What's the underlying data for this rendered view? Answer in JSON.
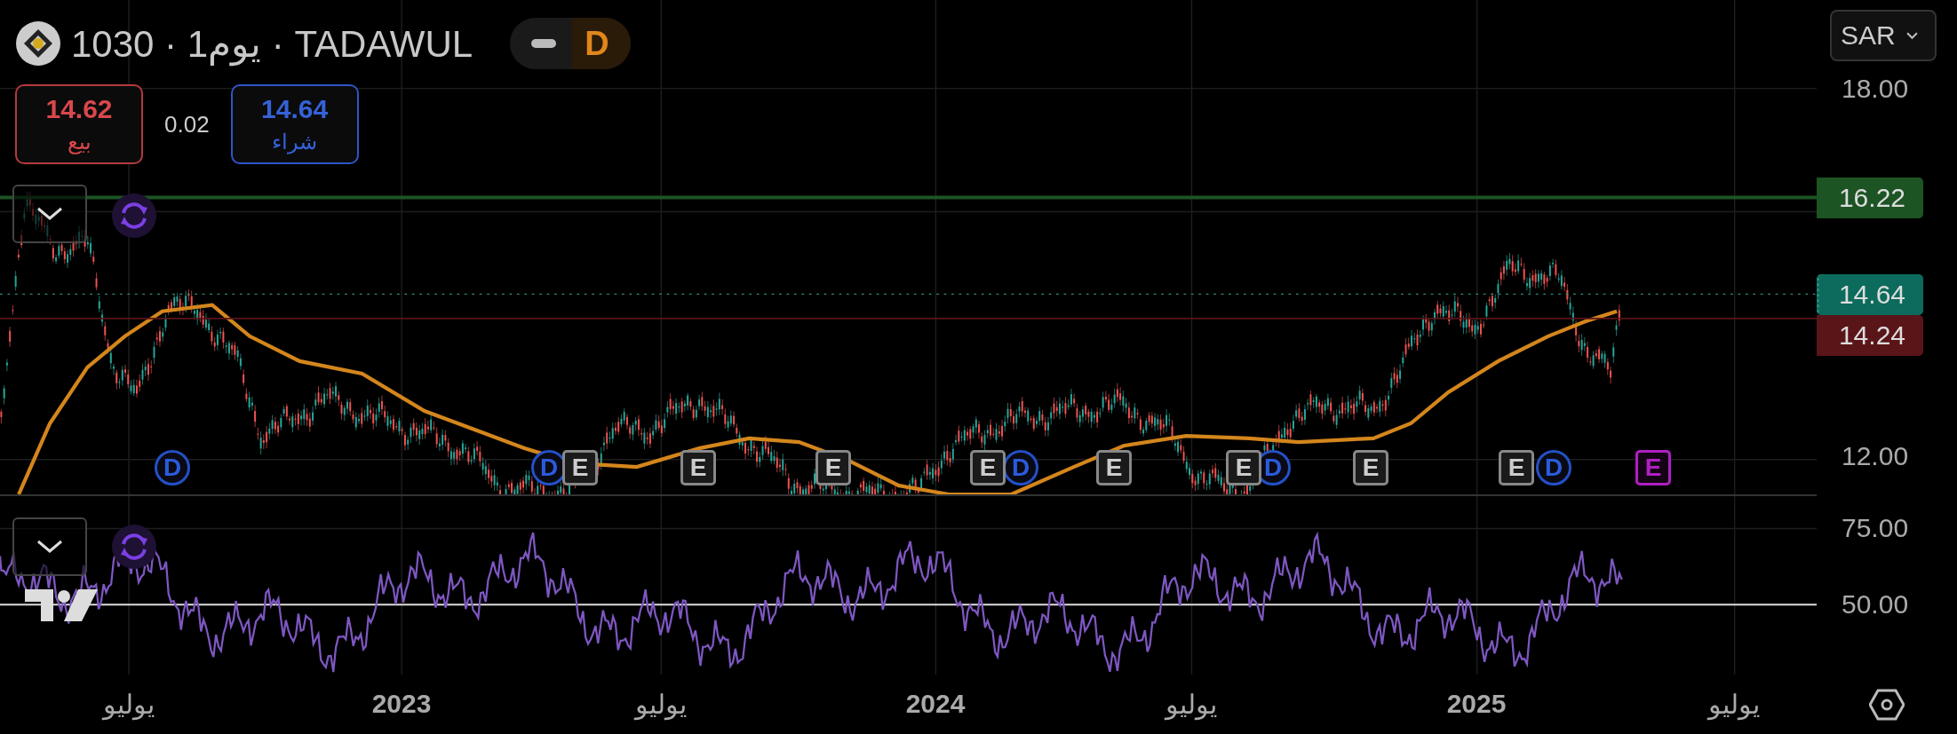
{
  "header": {
    "title": "1030 · 1يوم · TADAWUL",
    "mode_label": "D",
    "currency": "SAR"
  },
  "quote": {
    "sell": {
      "price": "14.62",
      "label": "بيع"
    },
    "spread": "0.02",
    "buy": {
      "price": "14.64",
      "label": "شراء"
    }
  },
  "price_axis": [
    "18.00",
    "12.00"
  ],
  "price_tags": [
    {
      "value": "16.22",
      "color": "#1d5424",
      "dashed": false
    },
    {
      "value": "14.64",
      "color": "#0c6b5c",
      "dashed": true
    },
    {
      "value": "14.24",
      "color": "#5a1519",
      "dashed": false
    }
  ],
  "rsi_axis": [
    "75.00",
    "50.00"
  ],
  "events": [
    {
      "kind": "upcoming",
      "label": "E"
    },
    {
      "kind": "dividend",
      "label": "D"
    },
    {
      "kind": "earnings",
      "label": "E"
    },
    {
      "kind": "earnings",
      "label": "E"
    },
    {
      "kind": "dividend",
      "label": "D"
    },
    {
      "kind": "earnings",
      "label": "E"
    },
    {
      "kind": "earnings",
      "label": "E"
    },
    {
      "kind": "dividend",
      "label": "D"
    },
    {
      "kind": "earnings",
      "label": "E"
    },
    {
      "kind": "earnings",
      "label": "E"
    },
    {
      "kind": "earnings",
      "label": "E"
    },
    {
      "kind": "earnings",
      "label": "E"
    },
    {
      "kind": "dividend",
      "label": "D"
    },
    {
      "kind": "dividend",
      "label": "D"
    }
  ],
  "time_axis": [
    {
      "label": "يوليو",
      "kind": "month"
    },
    {
      "label": "2025",
      "kind": "year"
    },
    {
      "label": "يوليو",
      "kind": "month"
    },
    {
      "label": "2024",
      "kind": "year"
    },
    {
      "label": "يوليو",
      "kind": "month"
    },
    {
      "label": "2023",
      "kind": "year"
    },
    {
      "label": "يوليو",
      "kind": "month"
    }
  ]
}
